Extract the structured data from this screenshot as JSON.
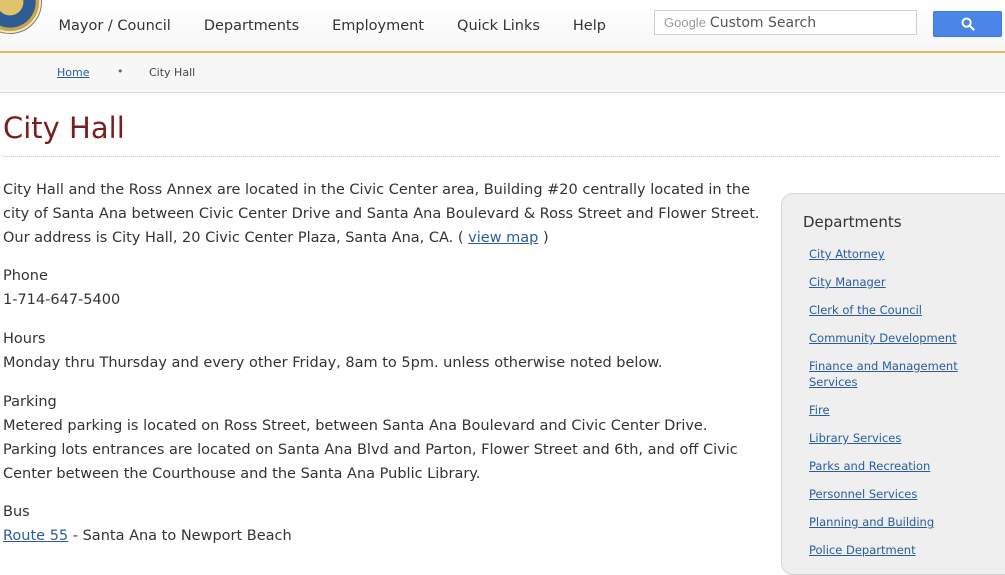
{
  "header": {
    "nav": [
      "Mayor / Council",
      "Departments",
      "Employment",
      "Quick Links",
      "Help"
    ],
    "search": {
      "brand": "Google",
      "placeholder": "Custom Search"
    }
  },
  "breadcrumb": {
    "home": "Home",
    "separator": "•",
    "current": "City Hall"
  },
  "page": {
    "title": "City Hall",
    "intro": "City Hall and the Ross Annex are located in the Civic Center area, Building #20 centrally located in the city of Santa Ana between Civic Center Drive and Santa Ana Boulevard & Ross Street and Flower Street. Our address is City Hall, 20 Civic Center Plaza, Santa Ana, CA. (",
    "view_map": "view map",
    "intro_close": ")",
    "phone_label": "Phone",
    "phone": "1-714-647-5400",
    "hours_label": "Hours",
    "hours": "Monday thru Thursday and every other Friday, 8am to 5pm. unless otherwise noted below.",
    "parking_label": "Parking",
    "parking": "Metered parking is located on Ross Street, between Santa Ana Boulevard and Civic Center Drive. Parking lots entrances are located on Santa Ana Blvd and Parton, Flower Street and 6th, and off Civic Center between the Courthouse and the Santa Ana Public Library.",
    "bus_label": "Bus",
    "bus_link": "Route 55",
    "bus_text": "- Santa Ana to Newport Beach"
  },
  "sidebar": {
    "title": "Departments",
    "items": [
      "City Attorney",
      "City Manager",
      "Clerk of the Council",
      "Community Development",
      "Finance and Management Services",
      "Fire",
      "Library Services",
      "Parks and Recreation",
      "Personnel Services",
      "Planning and Building",
      "Police Department"
    ]
  },
  "colors": {
    "title": "#7a1f1f",
    "link": "#2a5d9f",
    "accent_rule": "#e2b95a",
    "search_button": "#4a86e8"
  }
}
